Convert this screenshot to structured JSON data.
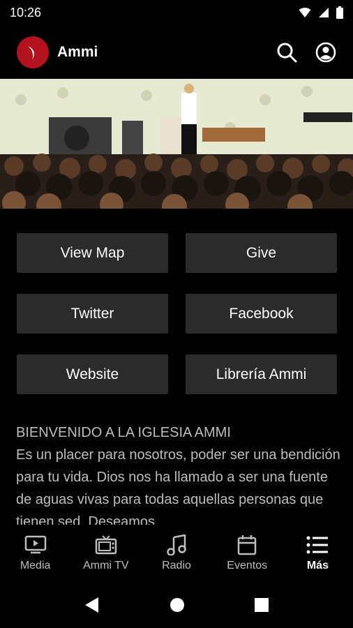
{
  "status": {
    "time": "10:26"
  },
  "app": {
    "title": "Ammi"
  },
  "buttons": [
    {
      "label": "View Map"
    },
    {
      "label": "Give"
    },
    {
      "label": "Twitter"
    },
    {
      "label": "Facebook"
    },
    {
      "label": "Website"
    },
    {
      "label": "Librería Ammi"
    }
  ],
  "welcome": {
    "heading": "BIENVENIDO A LA IGLESIA AMMI",
    "body": "Es un placer para nosotros, poder ser una bendición para tu vida. Dios nos ha llamado a ser una fuente de aguas vivas para todas aquellas personas que tienen sed. Deseamos"
  },
  "nav": {
    "items": [
      {
        "label": "Media",
        "icon": "media-icon"
      },
      {
        "label": "Ammi TV",
        "icon": "tv-icon"
      },
      {
        "label": "Radio",
        "icon": "music-note-icon"
      },
      {
        "label": "Eventos",
        "icon": "calendar-icon"
      },
      {
        "label": "Más",
        "icon": "list-icon",
        "active": true
      }
    ]
  },
  "colors": {
    "accent": "#b3121f",
    "button_bg": "#2b2b2b",
    "muted_text": "#bdbdbd"
  }
}
